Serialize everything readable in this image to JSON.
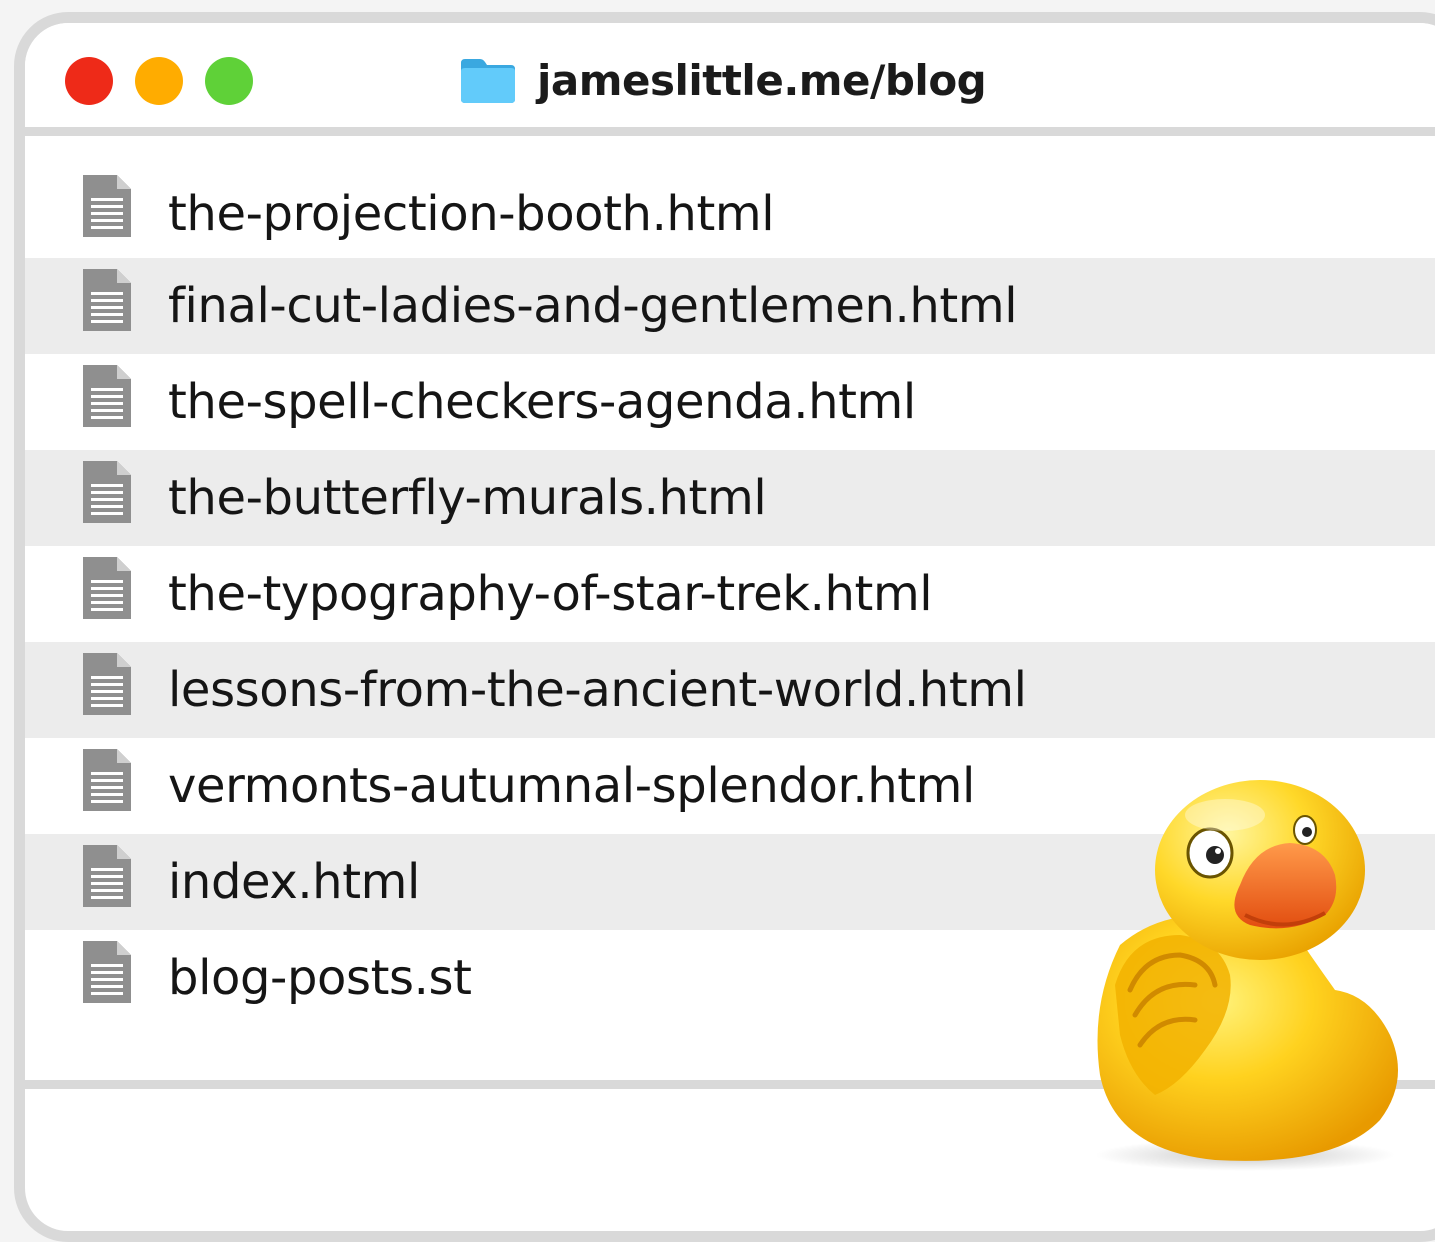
{
  "window": {
    "title": "jameslittle.me/blog",
    "folder_icon": "folder-icon",
    "traffic_lights": {
      "close": "#ee2a18",
      "minimize": "#ffac00",
      "maximize": "#5fd138"
    }
  },
  "files": [
    {
      "name": "the-projection-booth.html",
      "icon": "document-icon"
    },
    {
      "name": "final-cut-ladies-and-gentlemen.html",
      "icon": "document-icon"
    },
    {
      "name": "the-spell-checkers-agenda.html",
      "icon": "document-icon"
    },
    {
      "name": "the-butterfly-murals.html",
      "icon": "document-icon"
    },
    {
      "name": "the-typography-of-star-trek.html",
      "icon": "document-icon"
    },
    {
      "name": "lessons-from-the-ancient-world.html",
      "icon": "document-icon"
    },
    {
      "name": "vermonts-autumnal-splendor.html",
      "icon": "document-icon"
    },
    {
      "name": "index.html",
      "icon": "document-icon"
    },
    {
      "name": "blog-posts.st",
      "icon": "document-icon"
    }
  ],
  "decoration": {
    "mascot": "rubber-duck-icon"
  },
  "colors": {
    "row_alt": "#ececec",
    "border": "#d9d9d9",
    "folder": "#5ac8fa",
    "duck_body": "#ffcf1a",
    "duck_beak": "#f5661f"
  }
}
